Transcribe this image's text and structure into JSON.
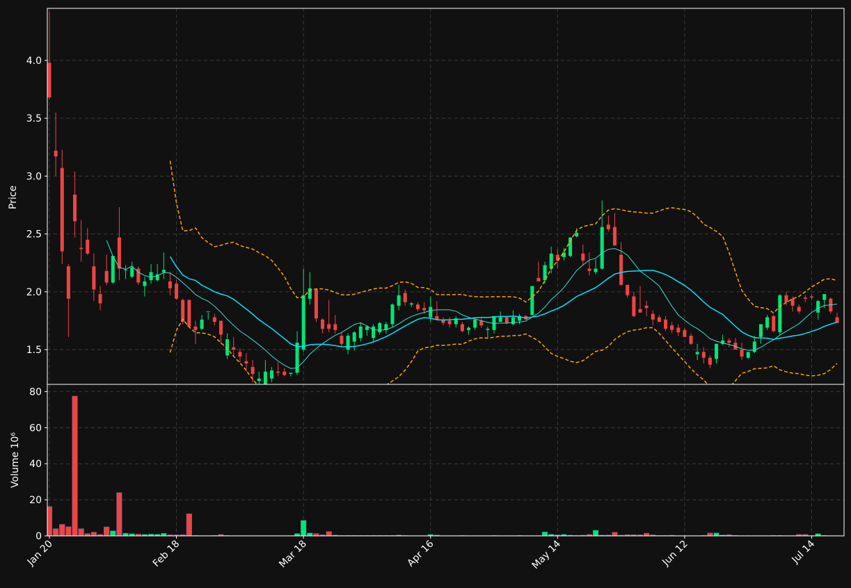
{
  "theme": {
    "background": "#111111",
    "grid": "#3a3a3a",
    "axis": "#ffffff",
    "up": "#00e676",
    "down": "#ef4444",
    "wick_up": "#00e676",
    "wick_down": "#ef4444",
    "ma_fast": "#40e0d0",
    "ma_slow": "#00e5ff",
    "band": "#ffa500"
  },
  "chart_data": {
    "type": "candlestick",
    "price_panel": {
      "ylabel": "Price",
      "ylim": [
        1.2,
        4.45
      ],
      "yticks": [
        1.5,
        2.0,
        2.5,
        3.0,
        3.5,
        4.0
      ],
      "ytick_labels": [
        "1.5",
        "2.0",
        "2.5",
        "3.0",
        "3.5",
        "4.0"
      ]
    },
    "volume_panel": {
      "ylabel": "Volume  10⁶",
      "ylim": [
        0,
        84
      ],
      "yticks": [
        0,
        20,
        40,
        60,
        80
      ],
      "ytick_labels": [
        "0",
        "20",
        "40",
        "60",
        "80"
      ]
    },
    "xticks": [
      {
        "index": 0,
        "label": "Jan 20"
      },
      {
        "index": 20,
        "label": "Feb 18"
      },
      {
        "index": 40,
        "label": "Mar 18"
      },
      {
        "index": 60,
        "label": "Apr 16"
      },
      {
        "index": 80,
        "label": "May 14"
      },
      {
        "index": 100,
        "label": "Jun 12"
      },
      {
        "index": 120,
        "label": "Jul 14"
      }
    ],
    "grid": true,
    "ohlc": [
      [
        3.98,
        4.42,
        3.66,
        3.68
      ],
      [
        3.22,
        3.55,
        3.0,
        3.17
      ],
      [
        3.07,
        3.23,
        2.24,
        2.35
      ],
      [
        2.22,
        2.24,
        1.61,
        1.94
      ],
      [
        2.84,
        3.04,
        2.47,
        2.61
      ],
      [
        2.38,
        2.62,
        2.26,
        2.37
      ],
      [
        2.45,
        2.55,
        2.32,
        2.33
      ],
      [
        2.22,
        2.33,
        1.92,
        2.02
      ],
      [
        1.98,
        2.05,
        1.84,
        1.9
      ],
      [
        2.18,
        2.32,
        2.06,
        2.08
      ],
      [
        2.08,
        2.3,
        2.07,
        2.31
      ],
      [
        2.47,
        2.73,
        2.1,
        2.2
      ],
      [
        2.19,
        2.23,
        2.11,
        2.19
      ],
      [
        2.13,
        2.26,
        2.12,
        2.21
      ],
      [
        2.2,
        2.22,
        2.06,
        2.08
      ],
      [
        2.05,
        2.13,
        1.96,
        2.09
      ],
      [
        2.1,
        2.24,
        2.07,
        2.17
      ],
      [
        2.1,
        2.24,
        2.09,
        2.15
      ],
      [
        2.17,
        2.34,
        2.11,
        2.19
      ],
      [
        2.09,
        2.17,
        1.97,
        2.03
      ],
      [
        2.07,
        2.1,
        1.93,
        1.94
      ],
      [
        1.93,
        1.94,
        1.72,
        1.74
      ],
      [
        1.93,
        1.93,
        1.69,
        1.7
      ],
      [
        1.7,
        1.75,
        1.55,
        1.67
      ],
      [
        1.68,
        1.8,
        1.67,
        1.76
      ],
      [
        1.83,
        1.82,
        1.76,
        1.83
      ],
      [
        1.78,
        1.81,
        1.71,
        1.74
      ],
      [
        1.75,
        1.75,
        1.55,
        1.63
      ],
      [
        1.45,
        1.64,
        1.42,
        1.59
      ],
      [
        1.52,
        1.61,
        1.44,
        1.5
      ],
      [
        1.48,
        1.51,
        1.39,
        1.44
      ],
      [
        1.4,
        1.47,
        1.31,
        1.38
      ],
      [
        1.35,
        1.41,
        1.22,
        1.29
      ],
      [
        1.23,
        1.31,
        1.18,
        1.25
      ],
      [
        1.2,
        1.41,
        1.15,
        1.31
      ],
      [
        1.25,
        1.35,
        1.22,
        1.32
      ],
      [
        1.31,
        1.39,
        1.27,
        1.3
      ],
      [
        1.31,
        1.34,
        1.27,
        1.28
      ],
      [
        1.29,
        1.29,
        1.27,
        1.3
      ],
      [
        1.3,
        1.66,
        1.28,
        1.56
      ],
      [
        1.5,
        2.2,
        1.48,
        1.97
      ],
      [
        1.94,
        2.17,
        1.89,
        2.03
      ],
      [
        2.02,
        2.02,
        1.74,
        1.77
      ],
      [
        1.76,
        1.77,
        1.64,
        1.68
      ],
      [
        1.72,
        1.93,
        1.65,
        1.68
      ],
      [
        1.72,
        1.8,
        1.64,
        1.67
      ],
      [
        1.62,
        1.65,
        1.53,
        1.55
      ],
      [
        1.5,
        1.64,
        1.46,
        1.62
      ],
      [
        1.57,
        1.66,
        1.49,
        1.65
      ],
      [
        1.6,
        1.73,
        1.57,
        1.7
      ],
      [
        1.67,
        1.71,
        1.62,
        1.7
      ],
      [
        1.6,
        1.72,
        1.57,
        1.7
      ],
      [
        1.65,
        1.74,
        1.63,
        1.73
      ],
      [
        1.67,
        1.74,
        1.64,
        1.72
      ],
      [
        1.72,
        1.9,
        1.69,
        1.89
      ],
      [
        1.88,
        2.06,
        1.84,
        1.97
      ],
      [
        1.99,
        2.02,
        1.88,
        1.91
      ],
      [
        1.89,
        1.91,
        1.87,
        1.9
      ],
      [
        1.89,
        1.91,
        1.83,
        1.85
      ],
      [
        1.86,
        1.91,
        1.81,
        1.84
      ],
      [
        1.78,
        1.96,
        1.74,
        1.87
      ],
      [
        1.79,
        1.92,
        1.77,
        1.76
      ],
      [
        1.76,
        1.78,
        1.71,
        1.73
      ],
      [
        1.75,
        1.78,
        1.69,
        1.72
      ],
      [
        1.72,
        1.79,
        1.69,
        1.77
      ],
      [
        1.72,
        1.74,
        1.65,
        1.66
      ],
      [
        1.67,
        1.7,
        1.63,
        1.69
      ],
      [
        1.69,
        1.76,
        1.67,
        1.76
      ],
      [
        1.75,
        1.77,
        1.69,
        1.71
      ],
      [
        1.67,
        1.7,
        1.6,
        1.68
      ],
      [
        1.67,
        1.79,
        1.64,
        1.79
      ],
      [
        1.74,
        1.83,
        1.74,
        1.78
      ],
      [
        1.78,
        1.79,
        1.72,
        1.73
      ],
      [
        1.72,
        1.84,
        1.71,
        1.78
      ],
      [
        1.75,
        1.81,
        1.72,
        1.79
      ],
      [
        1.79,
        1.8,
        1.76,
        1.76
      ],
      [
        1.8,
        2.05,
        1.8,
        2.05
      ],
      [
        2.12,
        2.26,
        2.09,
        2.09
      ],
      [
        2.1,
        2.26,
        2.07,
        2.23
      ],
      [
        2.2,
        2.39,
        2.16,
        2.33
      ],
      [
        2.32,
        2.37,
        2.2,
        2.27
      ],
      [
        2.3,
        2.38,
        2.27,
        2.34
      ],
      [
        2.31,
        2.47,
        2.3,
        2.47
      ],
      [
        2.48,
        2.55,
        2.47,
        2.51
      ],
      [
        2.33,
        2.41,
        2.23,
        2.27
      ],
      [
        2.2,
        2.34,
        2.14,
        2.18
      ],
      [
        2.17,
        2.28,
        2.15,
        2.2
      ],
      [
        2.2,
        2.79,
        2.19,
        2.56
      ],
      [
        2.58,
        2.66,
        2.52,
        2.54
      ],
      [
        2.56,
        2.68,
        2.4,
        2.4
      ],
      [
        2.32,
        2.43,
        2.05,
        2.06
      ],
      [
        2.06,
        2.06,
        1.95,
        1.97
      ],
      [
        1.96,
        2.0,
        1.78,
        1.79
      ],
      [
        1.85,
        2.05,
        1.83,
        1.82
      ],
      [
        1.88,
        1.92,
        1.79,
        1.86
      ],
      [
        1.81,
        1.84,
        1.71,
        1.76
      ],
      [
        1.78,
        1.8,
        1.74,
        1.74
      ],
      [
        1.76,
        1.79,
        1.66,
        1.68
      ],
      [
        1.71,
        1.74,
        1.64,
        1.67
      ],
      [
        1.69,
        1.72,
        1.62,
        1.65
      ],
      [
        1.67,
        1.69,
        1.61,
        1.61
      ],
      [
        1.62,
        1.64,
        1.54,
        1.55
      ],
      [
        1.46,
        1.55,
        1.41,
        1.48
      ],
      [
        1.48,
        1.52,
        1.38,
        1.43
      ],
      [
        1.43,
        1.45,
        1.34,
        1.37
      ],
      [
        1.42,
        1.5,
        1.38,
        1.55
      ],
      [
        1.55,
        1.63,
        1.54,
        1.58
      ],
      [
        1.58,
        1.6,
        1.52,
        1.56
      ],
      [
        1.56,
        1.6,
        1.51,
        1.5
      ],
      [
        1.5,
        1.56,
        1.41,
        1.44
      ],
      [
        1.43,
        1.47,
        1.42,
        1.48
      ],
      [
        1.48,
        1.62,
        1.47,
        1.57
      ],
      [
        1.61,
        1.7,
        1.55,
        1.72
      ],
      [
        1.69,
        1.8,
        1.67,
        1.78
      ],
      [
        1.79,
        1.8,
        1.65,
        1.66
      ],
      [
        1.65,
        1.98,
        1.63,
        1.97
      ],
      [
        1.97,
        2.0,
        1.88,
        1.91
      ],
      [
        1.94,
        1.96,
        1.83,
        1.88
      ],
      [
        1.87,
        1.89,
        1.81,
        1.83
      ],
      [
        1.95,
        1.97,
        1.91,
        1.94
      ],
      [
        1.96,
        1.98,
        1.93,
        1.95
      ],
      [
        1.82,
        1.93,
        1.76,
        1.92
      ],
      [
        1.93,
        1.98,
        1.86,
        1.98
      ],
      [
        1.94,
        1.95,
        1.81,
        1.83
      ],
      [
        1.78,
        1.82,
        1.75,
        1.73
      ]
    ],
    "volume": [
      16.3,
      4.0,
      6.4,
      5.1,
      77.5,
      4.0,
      1.3,
      2.1,
      0.8,
      5.0,
      2.8,
      24.0,
      1.5,
      1.2,
      1.0,
      0.8,
      1.0,
      0.9,
      1.4,
      0.6,
      0.6,
      0.7,
      12.3,
      0.3,
      0.2,
      0.2,
      0.3,
      0.8,
      0.3,
      0.2,
      0.2,
      0.2,
      0.2,
      0.2,
      0.2,
      0.2,
      0.2,
      0.2,
      0.2,
      1.3,
      8.6,
      1.6,
      1.3,
      0.6,
      2.4,
      0.5,
      0.3,
      0.3,
      0.3,
      0.3,
      0.3,
      0.3,
      0.3,
      0.3,
      0.3,
      0.5,
      0.3,
      0.2,
      0.2,
      0.2,
      0.8,
      0.5,
      0.2,
      0.2,
      0.2,
      0.3,
      0.2,
      0.2,
      0.2,
      0.2,
      0.3,
      0.2,
      0.2,
      0.2,
      0.3,
      0.2,
      0.2,
      0.2,
      2.2,
      0.9,
      0.6,
      0.8,
      0.4,
      0.3,
      0.4,
      0.8,
      3.1,
      0.4,
      0.5,
      2.0,
      0.4,
      0.7,
      0.7,
      0.6,
      1.5,
      0.6,
      0.3,
      0.3,
      0.4,
      0.2,
      0.2,
      0.2,
      0.2,
      0.3,
      1.6,
      1.6,
      0.5,
      0.7,
      0.3,
      0.2,
      0.2,
      0.2,
      0.2,
      0.2,
      0.3,
      0.3,
      0.2,
      0.2,
      0.8,
      0.8,
      0.2,
      1.2,
      0.3,
      0.2,
      0.2
    ]
  }
}
